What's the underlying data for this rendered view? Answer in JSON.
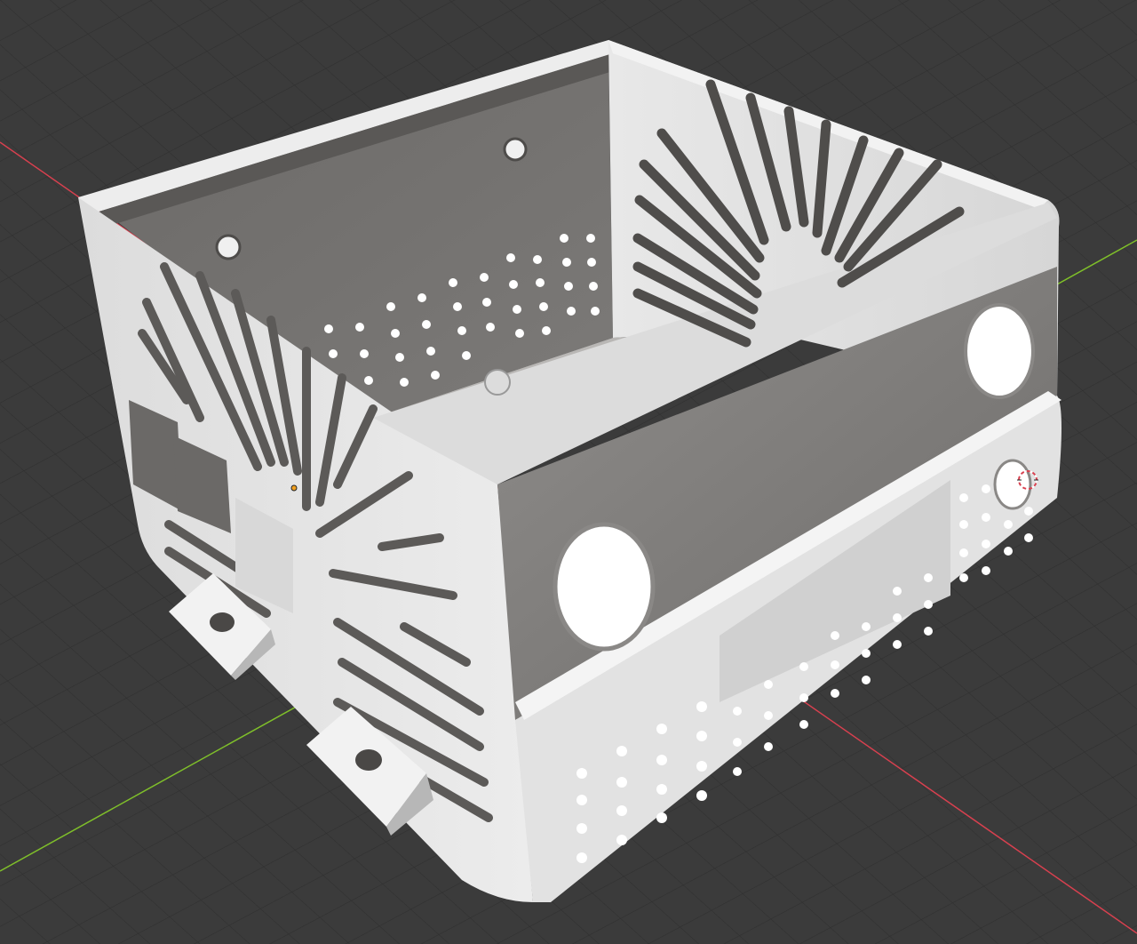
{
  "app": {
    "view": "3D viewport",
    "shading": "solid"
  },
  "scene": {
    "object": "enclosure-box",
    "grid": true,
    "axes": {
      "x_color": "#d8404f",
      "y_color": "#7fbf2a"
    }
  },
  "colors": {
    "background": "#3b3b3b",
    "grid_line": "#2e2e2e",
    "body_light": "#e6e6e6",
    "body_shadow": "#9a9a9a",
    "inner_wall": "#6a6866",
    "inner_dark": "#5a5856",
    "hole_fill": "#ffffff"
  },
  "markers": {
    "origin_color": "#f0a020",
    "cursor_colors": [
      "#ffffff",
      "#d8404f"
    ]
  }
}
